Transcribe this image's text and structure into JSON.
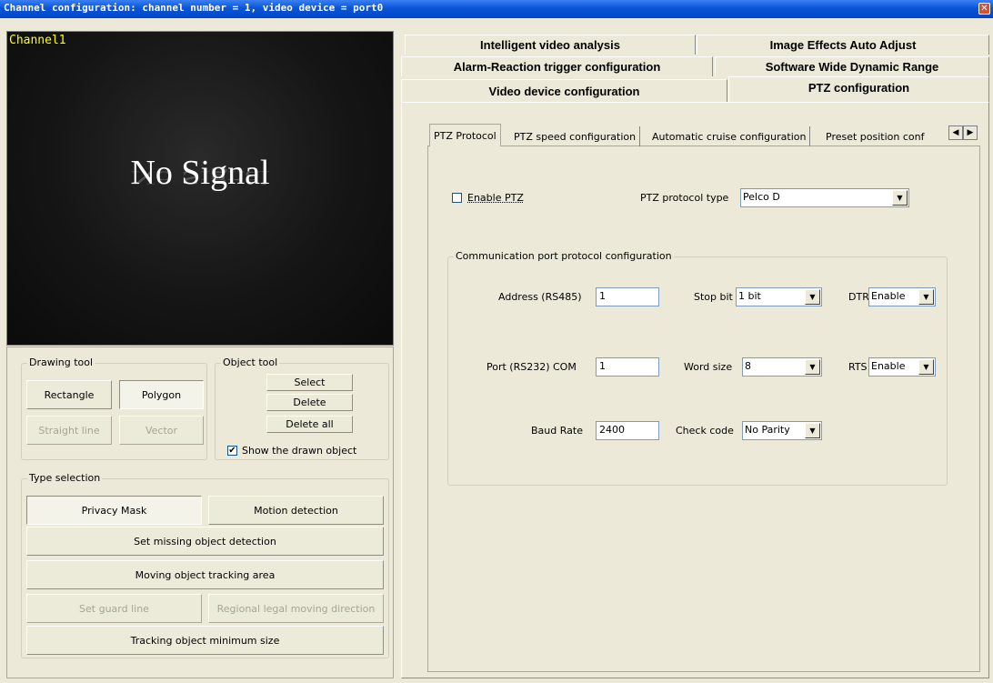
{
  "window": {
    "title": "Channel configuration: channel number = 1, video device = port0",
    "close_icon": "close-icon"
  },
  "video": {
    "channel_label": "Channel1",
    "status_text": "No Signal"
  },
  "drawing_tool": {
    "legend": "Drawing tool",
    "rectangle": "Rectangle",
    "polygon": "Polygon",
    "straight_line": "Straight line",
    "vector": "Vector"
  },
  "object_tool": {
    "legend": "Object tool",
    "select": "Select",
    "delete": "Delete",
    "delete_all": "Delete all",
    "show_drawn": "Show the drawn object",
    "show_drawn_checked": true
  },
  "type_selection": {
    "legend": "Type selection",
    "privacy_mask": "Privacy Mask",
    "motion_detection": "Motion detection",
    "missing_object": "Set missing object detection",
    "tracking_area": "Moving object tracking area",
    "guard_line": "Set guard line",
    "moving_direction": "Regional legal moving direction",
    "min_size": "Tracking object minimum size"
  },
  "main_tabs": {
    "intelligent_video": "Intelligent video analysis",
    "image_effects": "Image Effects Auto Adjust",
    "alarm_reaction": "Alarm-Reaction trigger configuration",
    "wide_dynamic": "Software Wide Dynamic Range",
    "video_device": "Video device configuration",
    "ptz": "PTZ configuration"
  },
  "sub_tabs": {
    "ptz_protocol": "PTZ Protocol",
    "ptz_speed": "PTZ speed configuration",
    "auto_cruise": "Automatic cruise configuration",
    "preset": "Preset position conf"
  },
  "ptz": {
    "enable_label": "Enable PTZ",
    "enable_checked": false,
    "protocol_type_label": "PTZ protocol type",
    "protocol_type_value": "Pelco D",
    "comm_legend": "Communication port protocol configuration",
    "address_label": "Address (RS485)",
    "address_value": "1",
    "stop_bit_label": "Stop bit",
    "stop_bit_value": "1  bit",
    "dtr_label": "DTR",
    "dtr_value": "Enable",
    "port_label": "Port (RS232)  COM",
    "port_value": "1",
    "word_size_label": "Word size",
    "word_size_value": "8",
    "rts_label": "RTS",
    "rts_value": "Enable",
    "baud_label": "Baud Rate",
    "baud_value": "2400",
    "check_code_label": "Check code",
    "check_code_value": "No Parity"
  }
}
